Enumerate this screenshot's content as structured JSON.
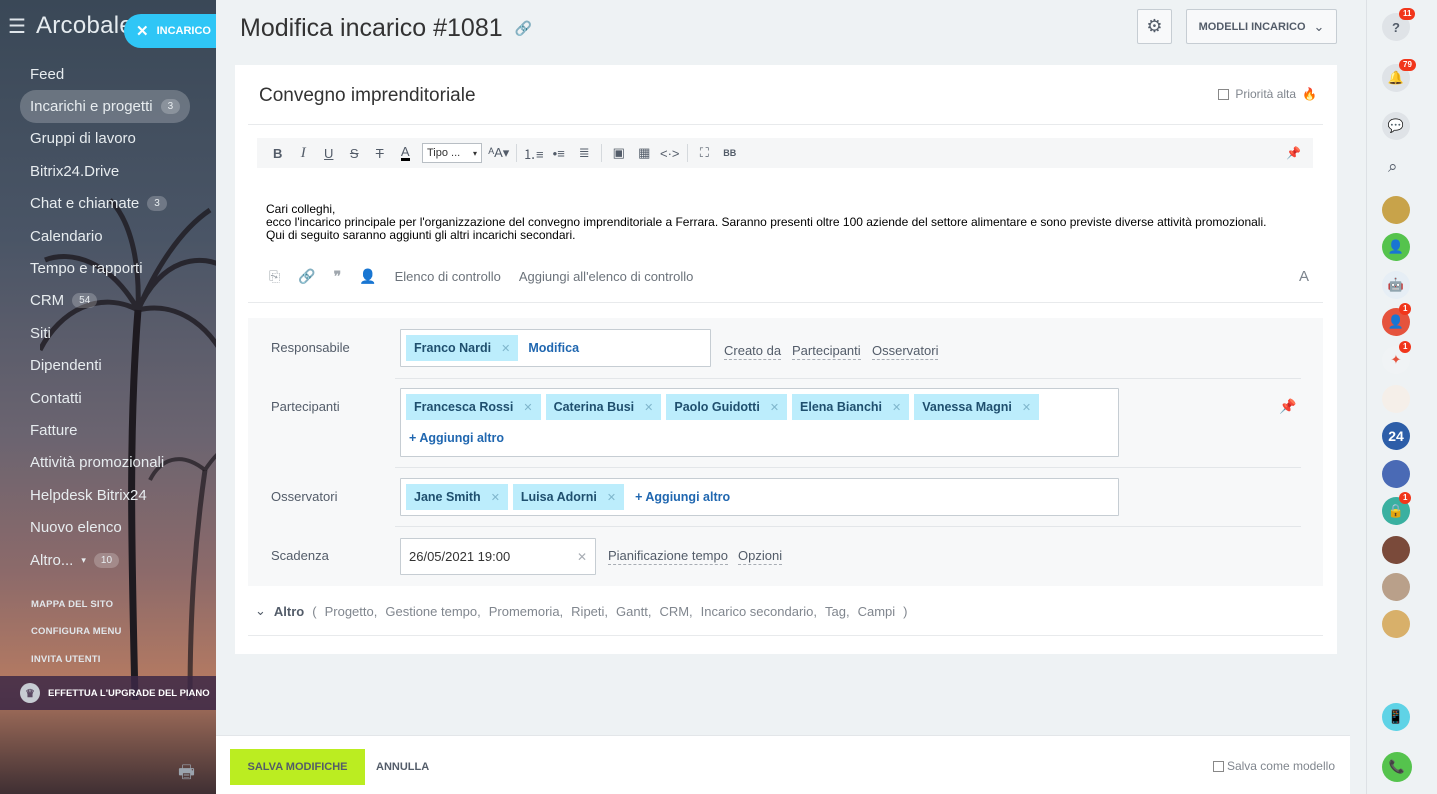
{
  "sidebar": {
    "logo": "Arcobale",
    "new_task_label": "INCARICO",
    "items": [
      {
        "label": "Feed",
        "count": ""
      },
      {
        "label": "Incarichi e progetti",
        "count": "3"
      },
      {
        "label": "Gruppi di lavoro",
        "count": ""
      },
      {
        "label": "Bitrix24.Drive",
        "count": ""
      },
      {
        "label": "Chat e chiamate",
        "count": "3"
      },
      {
        "label": "Calendario",
        "count": ""
      },
      {
        "label": "Tempo e rapporti",
        "count": ""
      },
      {
        "label": "CRM",
        "count": "54"
      },
      {
        "label": "Siti",
        "count": ""
      },
      {
        "label": "Dipendenti",
        "count": ""
      },
      {
        "label": "Contatti",
        "count": ""
      },
      {
        "label": "Fatture",
        "count": ""
      },
      {
        "label": "Attività promozionali",
        "count": ""
      },
      {
        "label": "Helpdesk Bitrix24",
        "count": ""
      },
      {
        "label": "Nuovo elenco",
        "count": ""
      },
      {
        "label": "Altro...",
        "count": "10"
      }
    ],
    "sitemap": "MAPPA DEL SITO",
    "configure_menu": "CONFIGURA MENU",
    "invite_users": "INVITA UTENTI",
    "upgrade": "EFFETTUA L'UPGRADE DEL PIANO"
  },
  "header": {
    "title": "Modifica incarico #1081",
    "models_label": "MODELLI INCARICO"
  },
  "task": {
    "title": "Convegno imprenditoriale",
    "priority_label": "Priorità alta",
    "toolbar_select": "Tipo ...",
    "body_lines": [
      "Cari colleghi,",
      "ecco l'incarico principale per l'organizzazione del convegno imprenditoriale a Ferrara. Saranno presenti oltre 100 aziende del settore alimentare e sono previste diverse attività promozionali.",
      "Qui di seguito saranno aggiunti gli altri incarichi secondari."
    ],
    "checklist_label": "Elenco di controllo",
    "add_checklist_label": "Aggiungi all'elenco di controllo",
    "font_label": "A"
  },
  "fields": {
    "responsible": {
      "label": "Responsabile",
      "person": "Franco Nardi",
      "modify": "Modifica",
      "links": [
        "Creato da",
        "Partecipanti",
        "Osservatori"
      ]
    },
    "participants": {
      "label": "Partecipanti",
      "people": [
        "Francesca Rossi",
        "Caterina Busi",
        "Paolo Guidotti",
        "Elena Bianchi",
        "Vanessa Magni"
      ],
      "add": "Aggiungi altro"
    },
    "observers": {
      "label": "Osservatori",
      "people": [
        "Jane Smith",
        "Luisa Adorni"
      ],
      "add": "Aggiungi altro"
    },
    "deadline": {
      "label": "Scadenza",
      "value": "26/05/2021 19:00",
      "links": [
        "Pianificazione tempo",
        "Opzioni"
      ]
    }
  },
  "more": {
    "label": "Altro",
    "items": [
      "Progetto,",
      "Gestione tempo,",
      "Promemoria,",
      "Ripeti,",
      "Gantt,",
      "CRM,",
      "Incarico secondario,",
      "Tag,",
      "Campi"
    ]
  },
  "footer": {
    "save_label": "SALVA MODIFICHE",
    "cancel_label": "ANNULLA",
    "save_template_label": "Salva come modello"
  },
  "rightbar": {
    "help_badge": "11",
    "notifications_badge": "79",
    "badge_one": "1",
    "bitrix_label": "24"
  },
  "colors": {
    "accent_blue": "#2fc6f6",
    "chip_bg": "#bcedfc",
    "save_green": "#bbed21",
    "badge_red": "#f1361b"
  }
}
